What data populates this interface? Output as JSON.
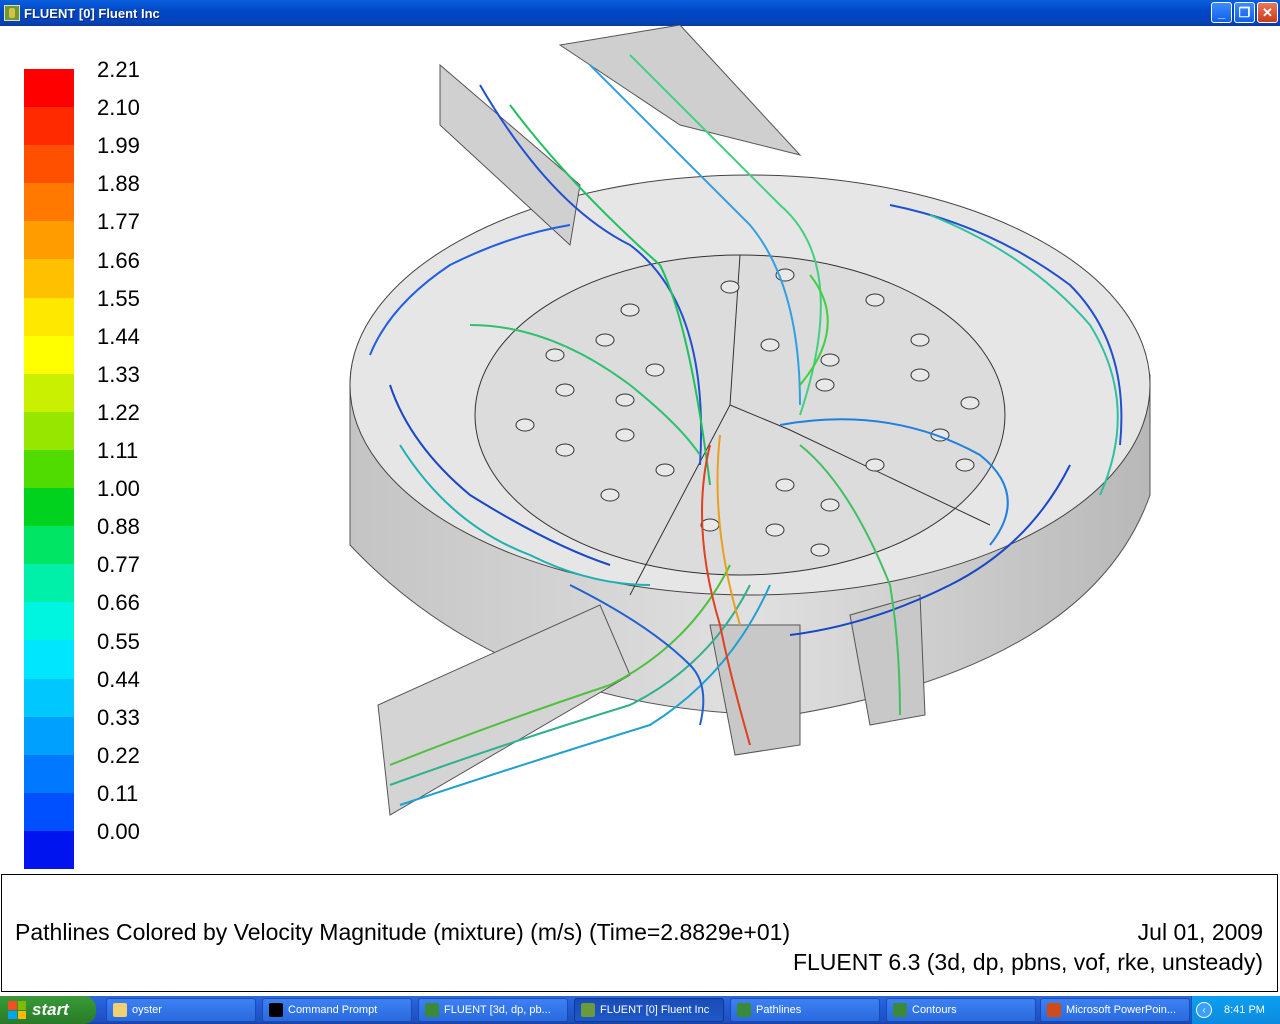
{
  "window": {
    "title": "FLUENT [0] Fluent Inc",
    "minimize_glyph": "_",
    "maximize_glyph": "❐",
    "close_glyph": "✕"
  },
  "colormap": {
    "labels": [
      "2.21",
      "2.10",
      "1.99",
      "1.88",
      "1.77",
      "1.66",
      "1.55",
      "1.44",
      "1.33",
      "1.22",
      "1.11",
      "1.00",
      "0.88",
      "0.77",
      "0.66",
      "0.55",
      "0.44",
      "0.33",
      "0.22",
      "0.11",
      "0.00"
    ],
    "colors": [
      "#ff0000",
      "#ff2a00",
      "#ff5000",
      "#ff7800",
      "#ff9c00",
      "#ffc000",
      "#ffe800",
      "#ffff00",
      "#c8f000",
      "#96e600",
      "#50dc00",
      "#00d21e",
      "#00e664",
      "#00f0aa",
      "#00f5e0",
      "#00e6ff",
      "#00c8ff",
      "#00a0ff",
      "#0078ff",
      "#0050ff",
      "#0014f0"
    ]
  },
  "caption": {
    "description": "Pathlines Colored by Velocity Magnitude (mixture)  (m/s)  (Time=2.8829e+01)",
    "date": "Jul 01, 2009",
    "solver": "FLUENT 6.3 (3d, dp, pbns, vof, rke, unsteady)"
  },
  "taskbar": {
    "start_label": "start",
    "tasks": [
      {
        "label": "oyster",
        "icon": "folder-icon",
        "color": "#f0d070"
      },
      {
        "label": "Command Prompt",
        "icon": "command-prompt-icon",
        "color": "#000000"
      },
      {
        "label": "FLUENT  [3d, dp, pb...",
        "icon": "fluent-window-icon",
        "color": "#3a8a3a"
      },
      {
        "label": "FLUENT [0] Fluent Inc",
        "icon": "fluent-app-icon",
        "color": "#6a9a3a"
      },
      {
        "label": "Pathlines",
        "icon": "fluent-window-icon",
        "color": "#3a8a3a"
      },
      {
        "label": "Contours",
        "icon": "fluent-window-icon",
        "color": "#3a8a3a"
      },
      {
        "label": "Microsoft PowerPoin...",
        "icon": "powerpoint-icon",
        "color": "#d04a1a"
      }
    ],
    "clock": "8:41 PM"
  }
}
